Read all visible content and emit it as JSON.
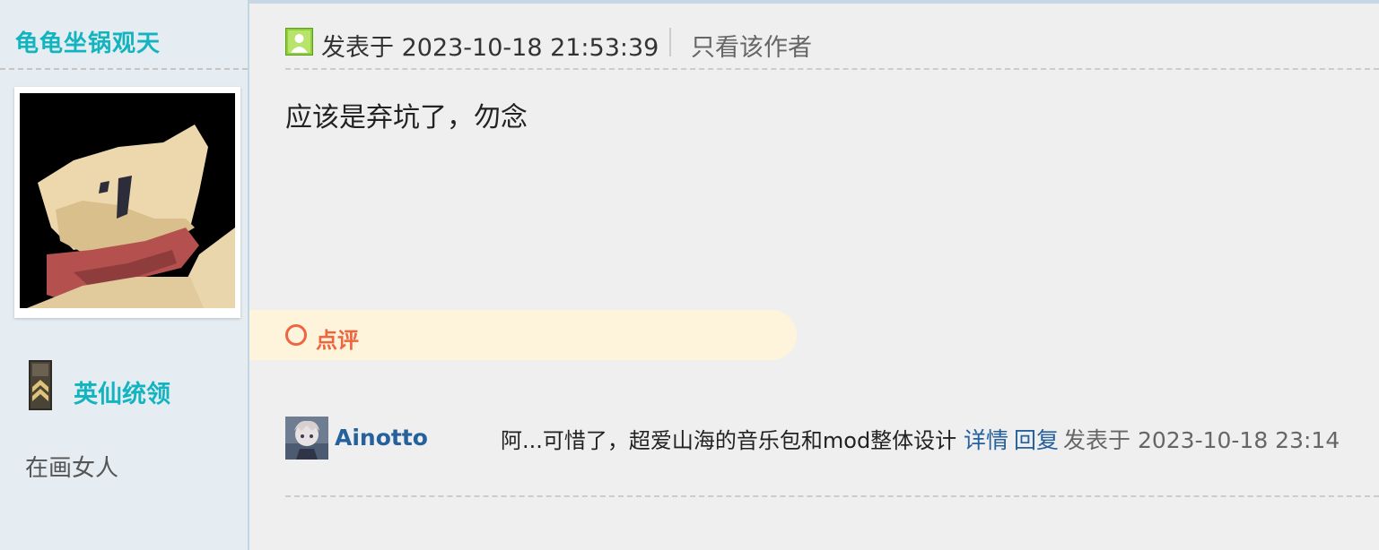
{
  "sidebar": {
    "username": "龟龟坐锅观天",
    "rank_title": "英仙统领",
    "subtitle": "在画女人",
    "avatar_icon": "hooded-character-avatar",
    "rank_icon": "rank-insignia-icon",
    "medals": [
      "wrench-medal",
      "orbit-medal",
      "circuit-medal"
    ]
  },
  "post": {
    "posted_at": "发表于 2023-10-18 21:53:39",
    "author_only_link": "只看该作者",
    "body": "应该是弃坑了，勿念"
  },
  "comments": {
    "section_label": "点评",
    "items": [
      {
        "author": "Ainotto",
        "text": "阿...可惜了，超爱山海的音乐包和mod整体设计",
        "details_link": "详情",
        "reply_link": "回复",
        "time": "发表于 2023-10-18 23:14"
      }
    ]
  },
  "colors": {
    "accent_teal": "#12b4c0",
    "link_blue": "#24619d",
    "comment_orange": "#ee6541",
    "banner_bg": "#fef4dc",
    "sidebar_bg": "#e5edf2"
  }
}
